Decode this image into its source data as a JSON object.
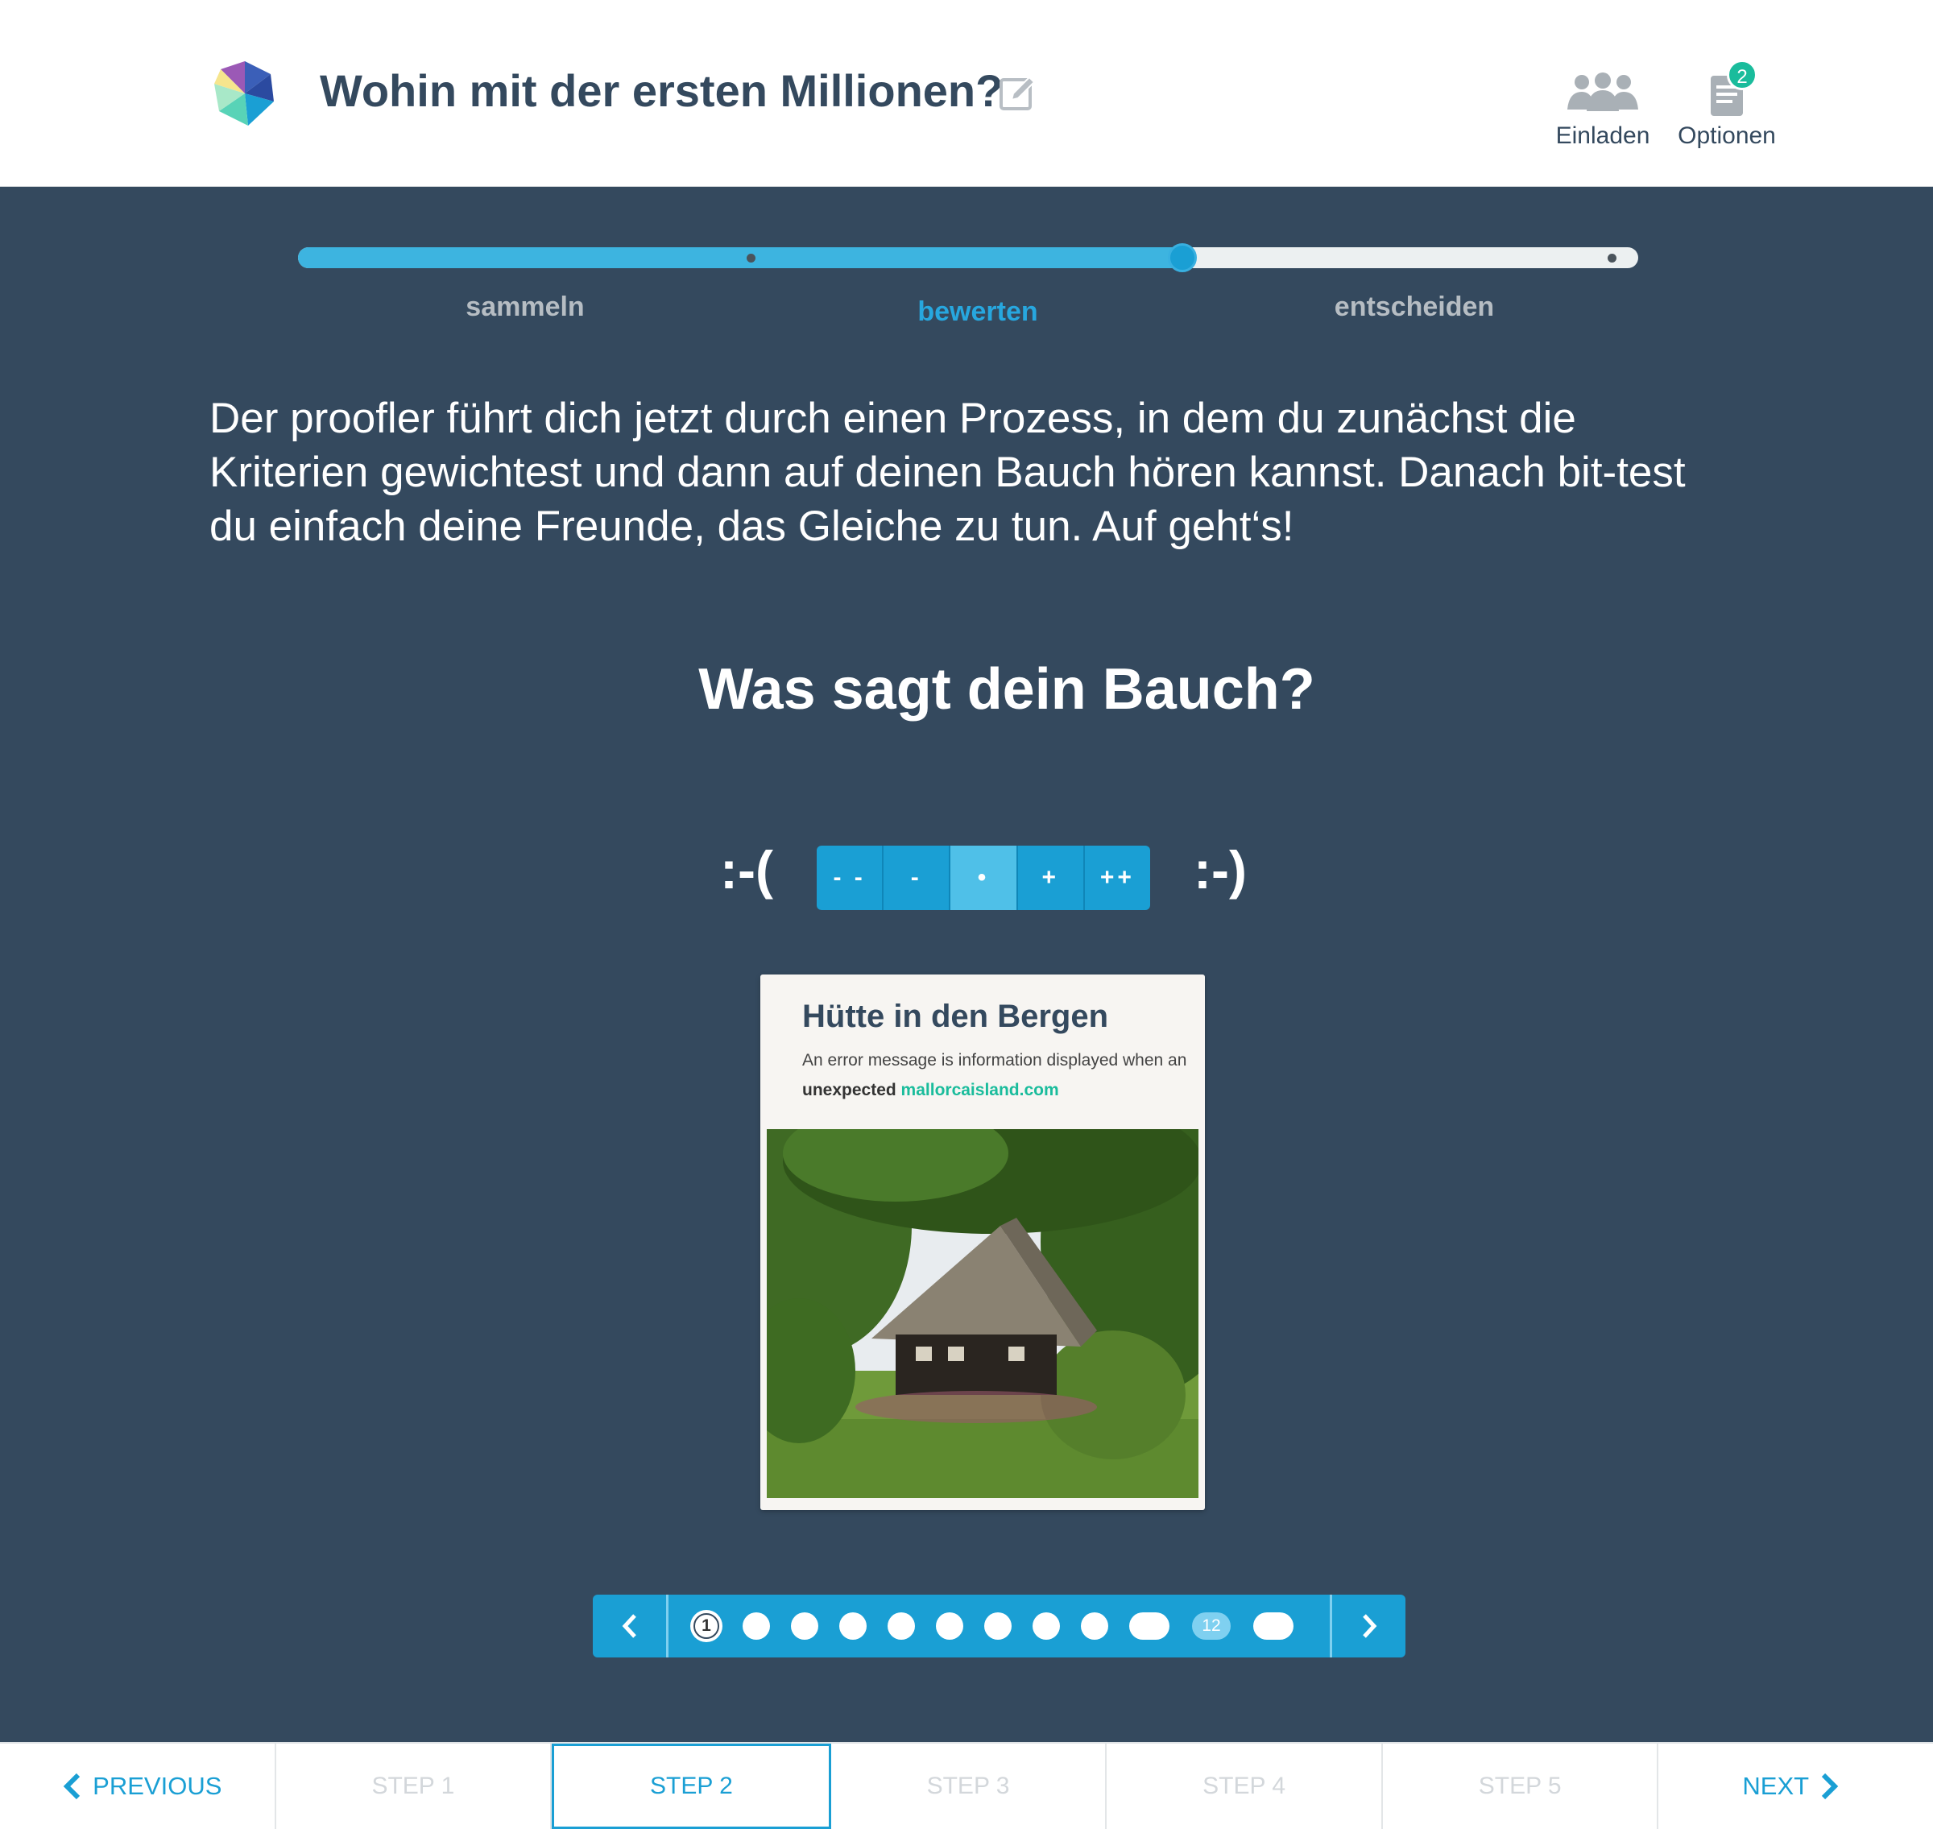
{
  "header": {
    "title": "Wohin mit der ersten Millionen?",
    "invite_label": "Einladen",
    "options_label": "Optionen",
    "options_badge": "2",
    "icons": {
      "logo": "logo-icon",
      "edit": "edit-icon",
      "invite": "people-icon",
      "options": "document-icon"
    }
  },
  "progress": {
    "value": 0.66,
    "phases": [
      "sammeln",
      "bewerten",
      "entscheiden"
    ],
    "active_phase": "bewerten"
  },
  "intro_text": "Der proofler führt dich jetzt durch einen Prozess, in dem du zunächst die Kriterien gewichtest und dann auf deinen Bauch hören kannst. Danach bit-test du einfach deine Freunde, das Gleiche zu tun. Auf geht‘s!",
  "question": "Was sagt dein Bauch?",
  "rating": {
    "sad": ":-(",
    "happy": ":-)",
    "options": [
      "- -",
      "-",
      "•",
      "+",
      "++"
    ],
    "selected": "•"
  },
  "card": {
    "title": "Hütte in den Bergen",
    "text_before": "An error message is information displayed when an",
    "text_bold": "unexpected",
    "link": "mallorcaisland.com",
    "image_subject": "cabin in the mountains"
  },
  "pager": {
    "current": "1",
    "count_label": "12"
  },
  "footer": {
    "previous": "PREVIOUS",
    "next": "NEXT",
    "steps": [
      "STEP 1",
      "STEP 2",
      "STEP 3",
      "STEP 4",
      "STEP 5"
    ],
    "active_step": "STEP 2"
  },
  "colors": {
    "accent": "#1a9fd4",
    "background": "#34495e",
    "badge": "#1abc9c"
  }
}
